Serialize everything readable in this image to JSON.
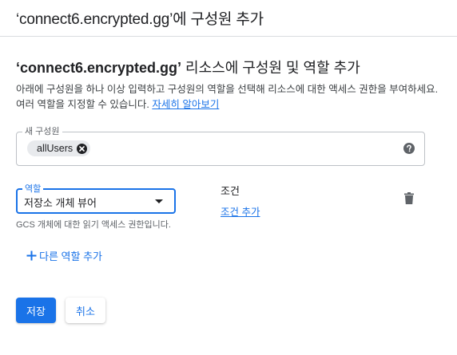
{
  "dialog": {
    "title": "‘connect6.encrypted.gg’에 구성원 추가"
  },
  "heading": {
    "resource": "‘connect6.encrypted.gg’",
    "suffix": " 리소스에 구성원 및 역할 추가"
  },
  "description": {
    "text": "아래에 구성원을 하나 이상 입력하고 구성원의 역할을 선택해 리소스에 대한 액세스 권한을 부여하세요. 여러 역할을 지정할 수 있습니다. ",
    "link": "자세히 알아보기"
  },
  "members": {
    "label": "새 구성원",
    "chips": [
      "allUsers"
    ],
    "help_icon": "help-circle-icon"
  },
  "role": {
    "label": "역할",
    "selected": "저장소 개체 뷰어",
    "helper": "GCS 개체에 대한 읽기 액세스 권한입니다."
  },
  "condition": {
    "label": "조건",
    "add_link": "조건 추가"
  },
  "actions": {
    "add_role": "다른 역할 추가",
    "save": "저장",
    "cancel": "취소"
  },
  "icons": {
    "delete": "trash-icon",
    "dropdown": "caret-down-icon",
    "add": "plus-icon",
    "chip_remove": "close-circle-icon"
  },
  "colors": {
    "accent": "#1a73e8",
    "text": "#202124",
    "muted": "#5f6368",
    "border": "#bdc1c6"
  }
}
